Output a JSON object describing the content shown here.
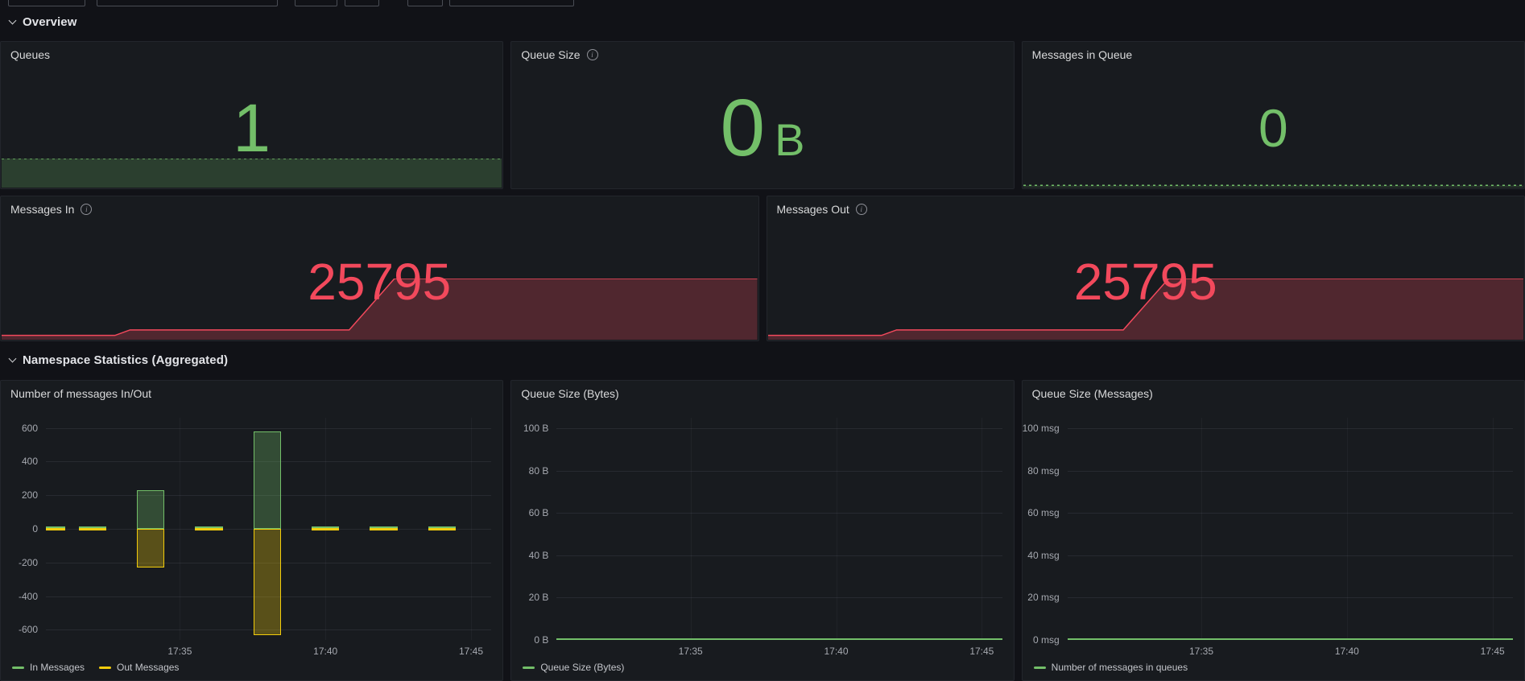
{
  "colors": {
    "green": "#73BF69",
    "yellow": "#F2CC0C",
    "red": "#F2495C",
    "page_bg": "#111217",
    "panel_bg": "#181b1f"
  },
  "sections": {
    "overview": "Overview",
    "namespace": "Namespace Statistics (Aggregated)"
  },
  "stat_panels": {
    "queues": {
      "title": "Queues",
      "value": "1",
      "color": "#73BF69"
    },
    "queue_size": {
      "title": "Queue Size",
      "value": "0",
      "unit": "B",
      "color": "#73BF69"
    },
    "messages_in_queue": {
      "title": "Messages in Queue",
      "value": "0",
      "color": "#73BF69"
    },
    "messages_in": {
      "title": "Messages In",
      "value": "25795",
      "color": "#F2495C"
    },
    "messages_out": {
      "title": "Messages Out",
      "value": "25795",
      "color": "#F2495C"
    }
  },
  "sparklines": {
    "queues": {
      "points": [
        [
          0,
          100
        ],
        [
          100,
          100
        ]
      ],
      "fill": "rgba(115,191,105,0.22)",
      "stroke": "#73BF69",
      "dash": "3,4"
    },
    "messages_in_queue": {
      "points": [
        [
          0,
          55
        ],
        [
          100,
          55
        ]
      ],
      "fill": "rgba(115,191,105,0.15)",
      "stroke": "#73BF69",
      "dash": "3,4"
    },
    "messages_in": {
      "points": [
        [
          0,
          7
        ],
        [
          15,
          7
        ],
        [
          17,
          16
        ],
        [
          46,
          16
        ],
        [
          52,
          100
        ],
        [
          100,
          100
        ]
      ],
      "fill": "rgba(242,73,92,0.26)",
      "stroke": "#F2495C"
    },
    "messages_out": {
      "points": [
        [
          0,
          7
        ],
        [
          15,
          7
        ],
        [
          17,
          16
        ],
        [
          47,
          16
        ],
        [
          53,
          100
        ],
        [
          100,
          100
        ]
      ],
      "fill": "rgba(242,73,92,0.26)",
      "stroke": "#F2495C"
    }
  },
  "chart_data": [
    {
      "type": "bar",
      "title": "Number of messages In/Out",
      "x_encoding": "minutes after 17:00",
      "time_range": "17:30 - 17:45",
      "x_axis": {
        "min": 30.4,
        "max": 45.7,
        "ticks": [
          {
            "pos": 35,
            "label": "17:35"
          },
          {
            "pos": 40,
            "label": "17:40"
          },
          {
            "pos": 45,
            "label": "17:45"
          }
        ]
      },
      "y_axis": {
        "min": -660,
        "max": 660,
        "ticks": [
          {
            "pos": 600,
            "label": "600"
          },
          {
            "pos": 400,
            "label": "400"
          },
          {
            "pos": 200,
            "label": "200"
          },
          {
            "pos": 0,
            "label": "0"
          },
          {
            "pos": -200,
            "label": "-200"
          },
          {
            "pos": -400,
            "label": "-400"
          },
          {
            "pos": -600,
            "label": "-600"
          }
        ]
      },
      "bar_width_minutes": 0.95,
      "series": [
        {
          "name": "In Messages",
          "color": "#73BF69",
          "points": [
            [
              30.6,
              0
            ],
            [
              32,
              0
            ],
            [
              34,
              230
            ],
            [
              36,
              0
            ],
            [
              38,
              580
            ],
            [
              40,
              0
            ],
            [
              42,
              0
            ],
            [
              44,
              0
            ]
          ]
        },
        {
          "name": "Out Messages",
          "color": "#F2CC0C",
          "points": [
            [
              30.6,
              0
            ],
            [
              32,
              0
            ],
            [
              34,
              -230
            ],
            [
              36,
              0
            ],
            [
              38,
              -630
            ],
            [
              40,
              0
            ],
            [
              42,
              0
            ],
            [
              44,
              0
            ]
          ]
        }
      ],
      "legend_position": "bottom"
    },
    {
      "type": "line",
      "title": "Queue Size (Bytes)",
      "x_encoding": "minutes after 17:00",
      "time_range": "17:30 - 17:45",
      "x_axis": {
        "min": 30.4,
        "max": 45.7,
        "ticks": [
          {
            "pos": 35,
            "label": "17:35"
          },
          {
            "pos": 40,
            "label": "17:40"
          },
          {
            "pos": 45,
            "label": "17:45"
          }
        ]
      },
      "y_axis": {
        "min": 0,
        "max": 105,
        "ticks": [
          {
            "pos": 100,
            "label": "100 B"
          },
          {
            "pos": 80,
            "label": "80 B"
          },
          {
            "pos": 60,
            "label": "60 B"
          },
          {
            "pos": 40,
            "label": "40 B"
          },
          {
            "pos": 20,
            "label": "20 B"
          },
          {
            "pos": 0,
            "label": "0 B"
          }
        ]
      },
      "series": [
        {
          "name": "Queue Size (Bytes)",
          "color": "#73BF69",
          "constant_value": 0
        }
      ],
      "legend_position": "bottom"
    },
    {
      "type": "line",
      "title": "Queue Size (Messages)",
      "x_encoding": "minutes after 17:00",
      "time_range": "17:30 - 17:45",
      "x_axis": {
        "min": 30.4,
        "max": 45.7,
        "ticks": [
          {
            "pos": 35,
            "label": "17:35"
          },
          {
            "pos": 40,
            "label": "17:40"
          },
          {
            "pos": 45,
            "label": "17:45"
          }
        ]
      },
      "y_axis": {
        "min": 0,
        "max": 105,
        "ticks": [
          {
            "pos": 100,
            "label": "100 msg"
          },
          {
            "pos": 80,
            "label": "80 msg"
          },
          {
            "pos": 60,
            "label": "60 msg"
          },
          {
            "pos": 40,
            "label": "40 msg"
          },
          {
            "pos": 20,
            "label": "20 msg"
          },
          {
            "pos": 0,
            "label": "0 msg"
          }
        ]
      },
      "series": [
        {
          "name": "Number of messages in queues",
          "color": "#73BF69",
          "constant_value": 0
        }
      ],
      "legend_position": "bottom"
    }
  ]
}
